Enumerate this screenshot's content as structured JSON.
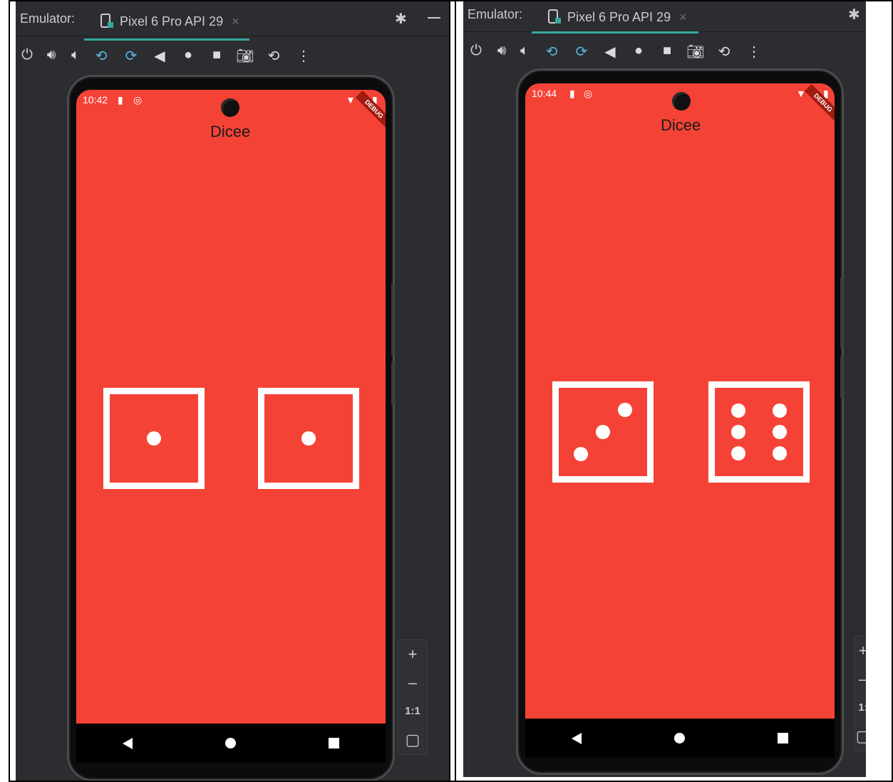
{
  "left": {
    "toolbar": {
      "emulator_label": "Emulator:",
      "tab_label": "Pixel 6 Pro API 29",
      "tab_close": "×"
    },
    "status_time": "10:42",
    "app_title": "Dicee",
    "debug_label": "DEBUG",
    "dice": [
      {
        "value": 1
      },
      {
        "value": 1
      }
    ],
    "zoom": {
      "plus": "+",
      "minus": "–",
      "one_to_one": "1:1"
    }
  },
  "right": {
    "toolbar": {
      "emulator_label": "Emulator:",
      "tab_label": "Pixel 6 Pro API 29",
      "tab_close": "×"
    },
    "status_time": "10:44",
    "app_title": "Dicee",
    "debug_label": "DEBUG",
    "dice": [
      {
        "value": 3
      },
      {
        "value": 6
      }
    ],
    "zoom": {
      "plus": "+",
      "minus": "–",
      "one_to_one": "1:"
    }
  },
  "colors": {
    "screen_bg": "#f44336",
    "ide_bg": "#2b2d30",
    "tab_underline": "#35a7a0"
  },
  "toolbar_icons": [
    "power-icon",
    "volume-up-icon",
    "volume-down-icon",
    "rotate-left-icon",
    "rotate-right-icon",
    "back-icon",
    "home-icon",
    "overview-icon",
    "camera-icon",
    "snapshot-icon",
    "more-icon"
  ]
}
